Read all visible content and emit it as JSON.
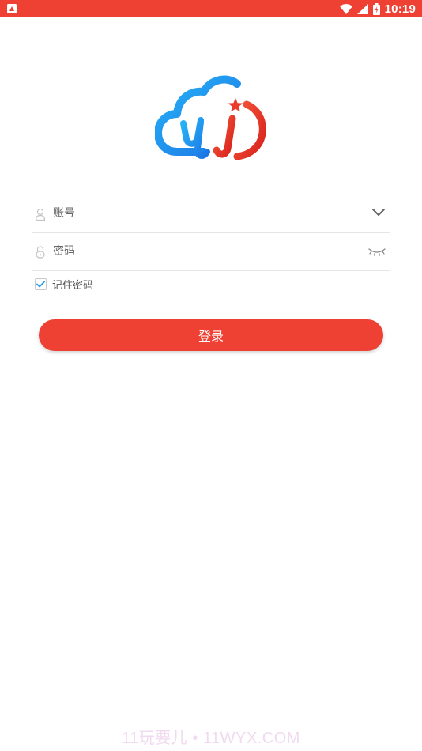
{
  "status_bar": {
    "time": "10:19",
    "background": "#ef4034",
    "left_icon": "notification-a-icon",
    "icons": [
      "wifi-icon",
      "signal-icon",
      "battery-icon"
    ]
  },
  "logo": {
    "icon": "cloud-yj-logo",
    "colors": {
      "blue": "#1e9cf0",
      "red": "#ea3b2d"
    }
  },
  "form": {
    "account": {
      "placeholder": "账号",
      "value": "",
      "icon": "user-icon",
      "trailing_icon": "chevron-down-icon"
    },
    "password": {
      "placeholder": "密码",
      "value": "",
      "icon": "lock-icon",
      "trailing_icon": "eye-closed-icon"
    },
    "remember": {
      "label": "记住密码",
      "checked": true
    }
  },
  "login_button": {
    "label": "登录",
    "color": "#ef4034"
  },
  "watermark": {
    "text": "11玩要儿 • 11WYX.COM"
  }
}
